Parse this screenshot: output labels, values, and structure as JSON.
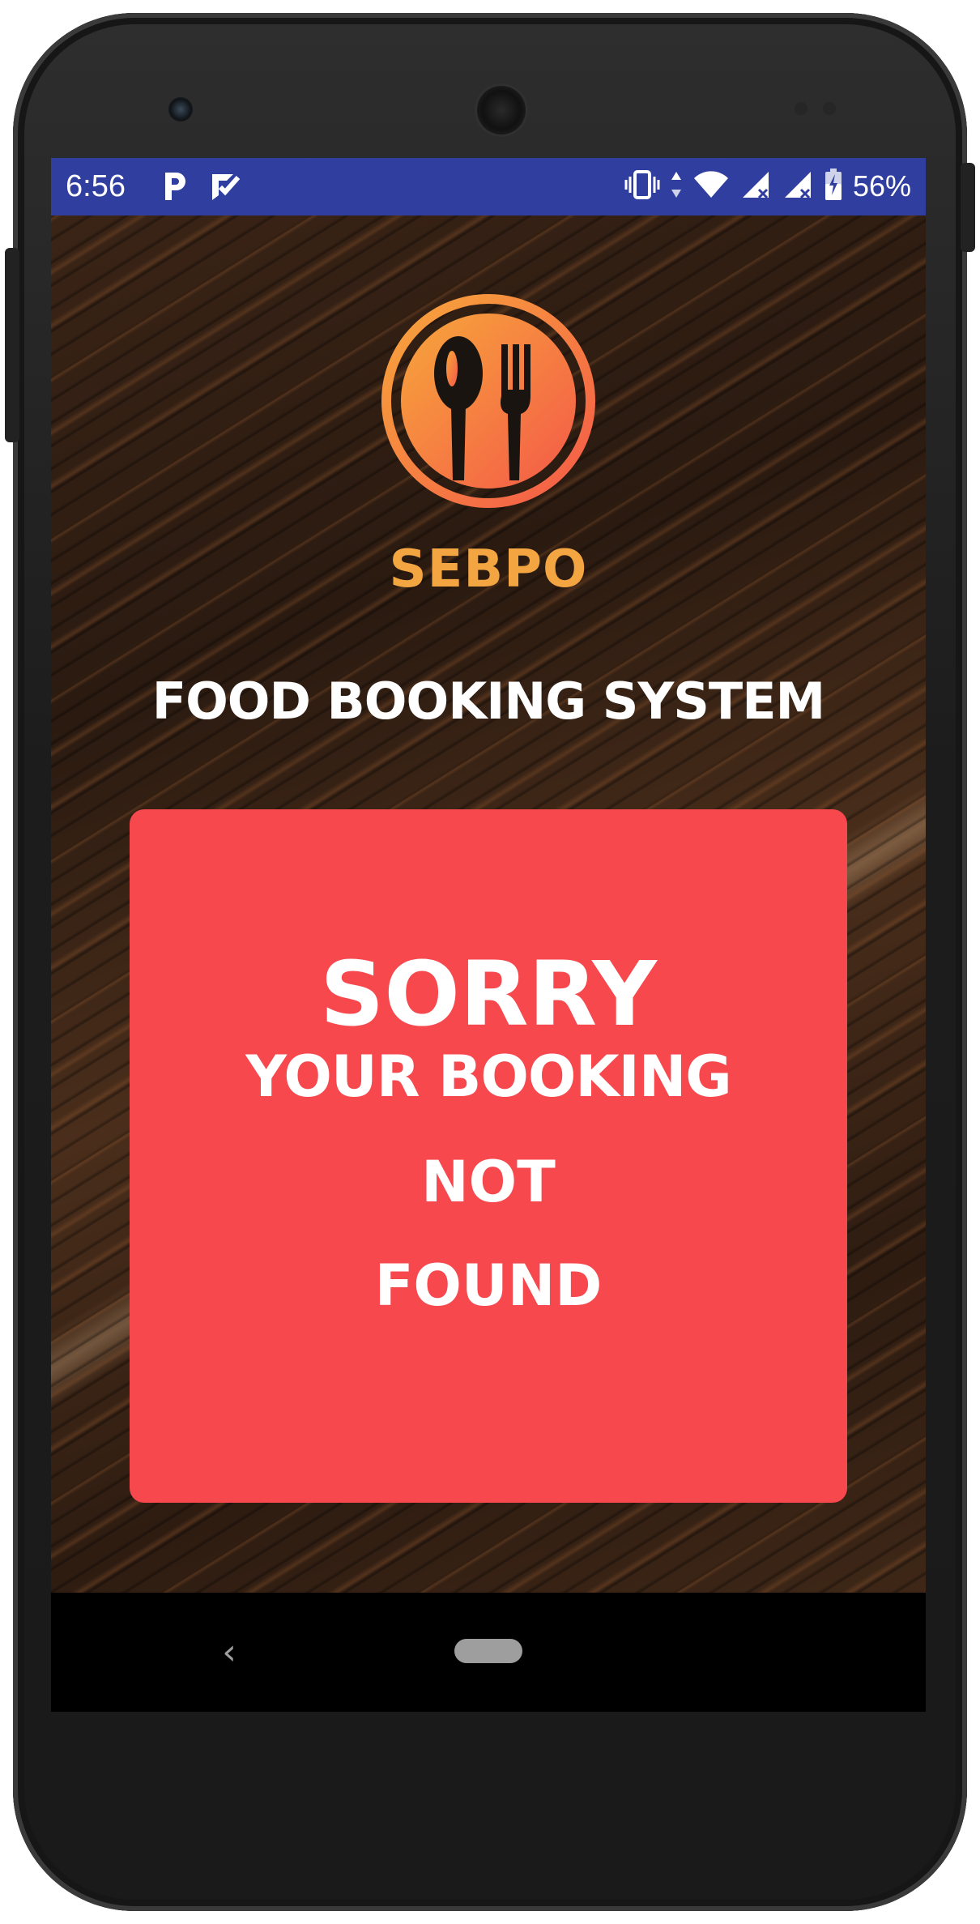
{
  "status_bar": {
    "time": "6:56",
    "battery_percent": "56%",
    "background_color": "#303f9f",
    "left_icons": [
      "parking-app-icon",
      "task-check-icon"
    ],
    "right_icons": [
      "vibrate-icon",
      "data-arrows-icon",
      "wifi-icon",
      "signal-icon",
      "signal-icon",
      "battery-icon"
    ]
  },
  "app": {
    "logo_icon": "spoon-fork-icon",
    "brand_name": "SEBPO",
    "brand_color": "#f2a541",
    "subtitle": "FOOD BOOKING SYSTEM",
    "error": {
      "title": "SORRY",
      "line1": "YOUR BOOKING",
      "line2": "NOT",
      "line3": "FOUND",
      "background_color": "#f7484e"
    }
  },
  "nav_bar": {
    "back_glyph": "‹",
    "icons": [
      "back-icon",
      "home-pill-icon"
    ]
  }
}
